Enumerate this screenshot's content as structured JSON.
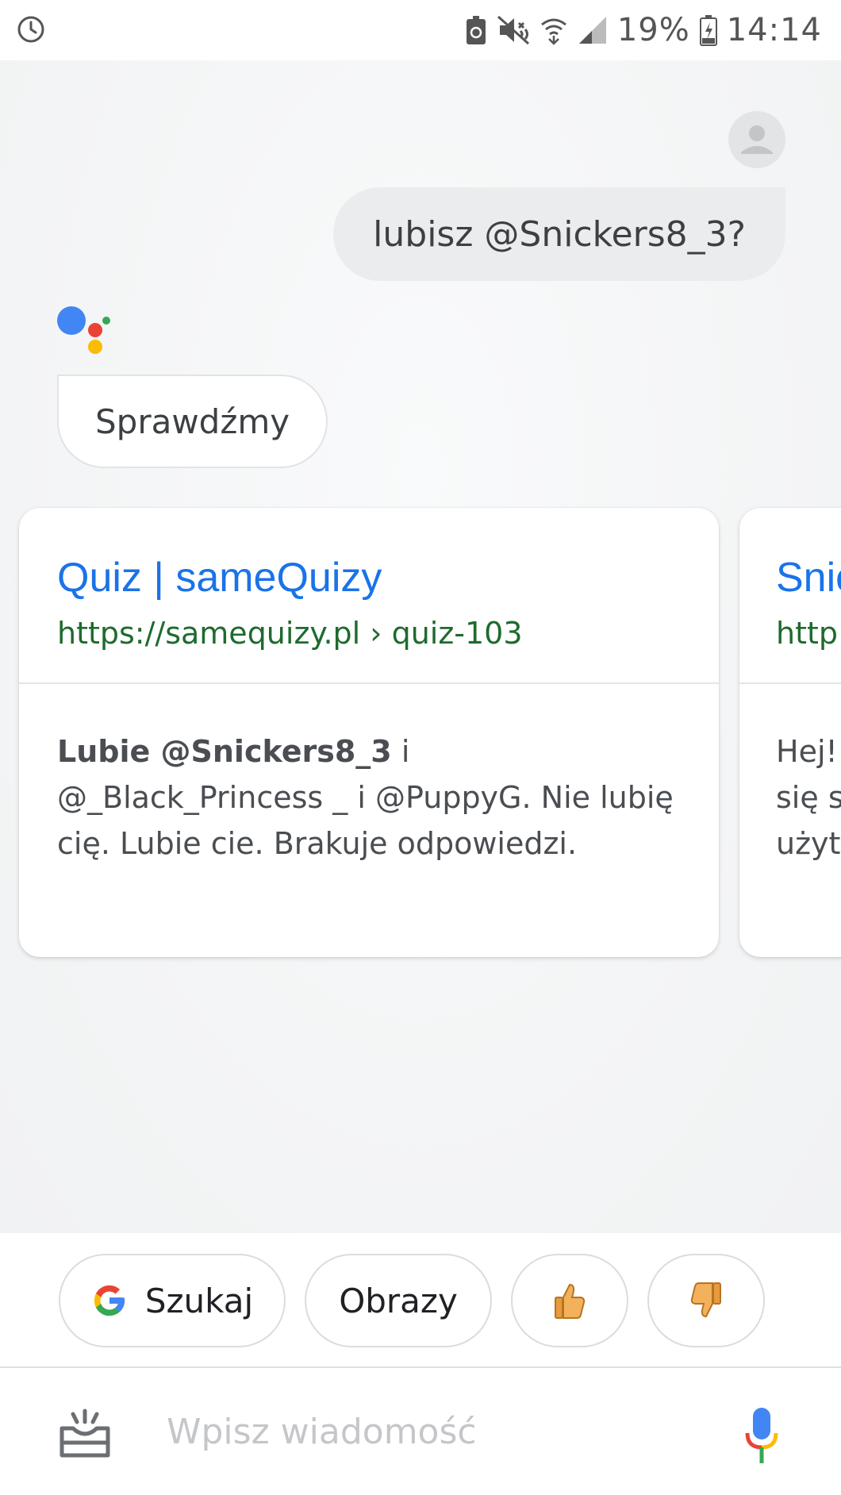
{
  "status_bar": {
    "battery_percent": "19%",
    "time": "14:14",
    "icons": [
      "alarm-icon",
      "battery-saver-icon",
      "vibrate-icon",
      "wifi-icon",
      "signal-icon",
      "battery-charging-icon"
    ]
  },
  "conversation": {
    "user_message": "lubisz @Snickers8_3?",
    "assistant_reply": "Sprawdźmy"
  },
  "results": [
    {
      "title": "Quiz | sameQuizy",
      "url": "https://samequizy.pl › quiz-103",
      "snippet_bold": "Lubie @Snickers8_3",
      "snippet_rest": " i @_Black_Princess _ i @PuppyG. Nie lubię cię. Lubie cie. Brakuje odpowiedzi."
    },
    {
      "title": "Snic",
      "url": "http",
      "snippet_lines": [
        "Hej!",
        "się s",
        "użyt"
      ]
    }
  ],
  "chips": {
    "search": "Szukaj",
    "images": "Obrazy",
    "like_icon": "thumbs-up-icon",
    "dislike_icon": "thumbs-down-icon"
  },
  "input": {
    "placeholder": "Wpisz wiadomość"
  },
  "colors": {
    "link_blue": "#1a73e8",
    "url_green": "#1e6b2e",
    "google_blue": "#4285f4",
    "google_red": "#ea4335",
    "google_yellow": "#fbbc05",
    "google_green": "#34a853"
  }
}
